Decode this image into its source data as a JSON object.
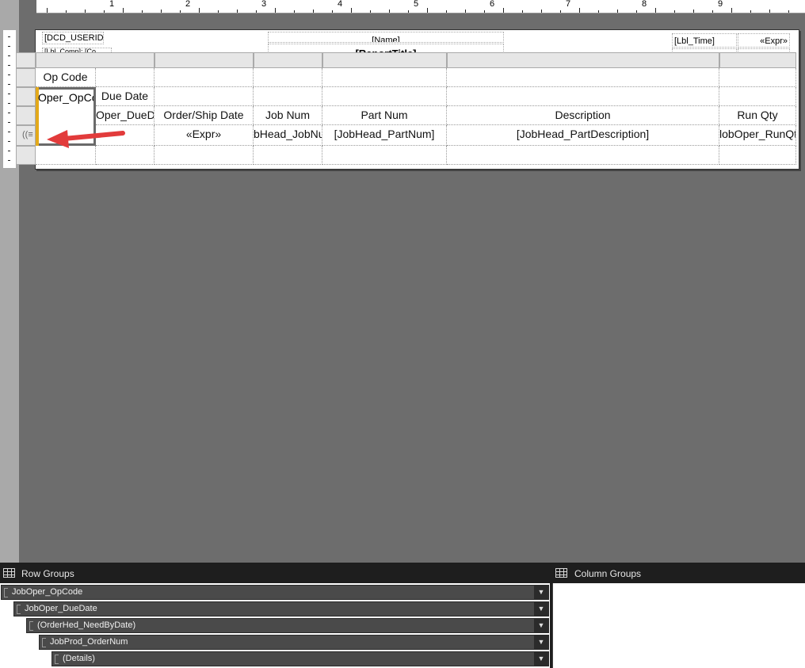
{
  "ruler": {
    "numbers": [
      "1",
      "2",
      "3",
      "4",
      "5",
      "6",
      "7",
      "8",
      "9"
    ]
  },
  "header": {
    "user_id": "[DCD_USERID",
    "name": "[Name]",
    "report_title": "[ReportTitle]",
    "truncated_field": "[Lbl_Comp]: [Co",
    "lbl_time": "[Lbl_Time]",
    "expr": "«Expr»"
  },
  "tablix": {
    "rows": [
      [
        "Op Code",
        "",
        "",
        "",
        "",
        "",
        ""
      ],
      [
        "",
        "Due Date",
        "",
        "",
        "",
        "",
        ""
      ],
      [
        "",
        "Oper_DueD",
        "Order/Ship Date",
        "Job Num",
        "Part Num",
        "Description",
        "Run Qty"
      ],
      [
        "",
        "",
        "«Expr»",
        "bHead_JobNu",
        "[JobHead_PartNum]",
        "[JobHead_PartDescription]",
        "lobOper_RunQty"
      ],
      [
        "",
        "",
        "",
        "",
        "",
        "",
        ""
      ]
    ],
    "selected_cell_text": "Oper_OpCo"
  },
  "row_groups": {
    "title": "Row Groups",
    "items": [
      {
        "label": "JobOper_OpCode"
      },
      {
        "label": "JobOper_DueDate"
      },
      {
        "label": "(OrderHed_NeedByDate)"
      },
      {
        "label": "JobProd_OrderNum"
      },
      {
        "label": "(Details)"
      }
    ]
  },
  "column_groups": {
    "title": "Column Groups"
  },
  "colors": {
    "accent_red": "#e23b3b",
    "selection_gold": "#e3a91a"
  }
}
